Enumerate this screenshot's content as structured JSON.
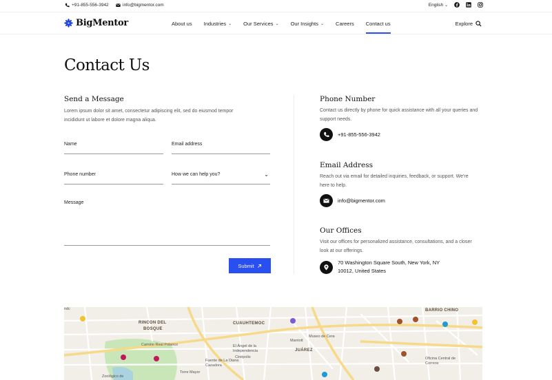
{
  "topbar": {
    "phone": "+91-855-556-3942",
    "email": "info@bigmentor.com",
    "language": "English",
    "social_icons": [
      "facebook-icon",
      "linkedin-icon",
      "instagram-icon"
    ]
  },
  "nav": {
    "brand": "BigMentor",
    "links": [
      {
        "label": "About us",
        "dropdown": false
      },
      {
        "label": "Industries",
        "dropdown": true
      },
      {
        "label": "Our Services",
        "dropdown": true
      },
      {
        "label": "Our Insights",
        "dropdown": true
      },
      {
        "label": "Careers",
        "dropdown": false
      },
      {
        "label": "Contact us",
        "dropdown": false,
        "active": true
      }
    ],
    "explore": "Explore"
  },
  "page": {
    "title": "Contact Us"
  },
  "form": {
    "title": "Send a Message",
    "description": "Lorem ipsum dolor sit amet, consectetur adipiscing elit, sed do eiusmod tempor incididunt ut labore et dolore magna aliqua.",
    "name_label": "Name",
    "email_label": "Email address",
    "phone_label": "Phone number",
    "help_label": "How we can help you?",
    "message_label": "Message",
    "submit_label": "Submit"
  },
  "contact": {
    "phone": {
      "title": "Phone Number",
      "description": "Contact us directly by phone for quick assistance with all your queries and support needs.",
      "value": "+91-855-556-3942"
    },
    "email": {
      "title": "Email Address",
      "description": "Reach out via email for detailed inquiries, feedback, or support. We're here to help.",
      "value": "info@bigmentor.com"
    },
    "offices": {
      "title": "Our Offices",
      "description": "Visit our offices for personalized assistance, consultations, and a closer look at our offerings.",
      "address_line1": "70 Washington Square South, New York, NY",
      "address_line2": "10012, United States"
    }
  },
  "map": {
    "labels": {
      "rincon": "RINCON DEL",
      "bosque": "BOSQUE",
      "cuauhtemoc": "CUAUHTEMOC",
      "barrio": "BARRIO CHINO",
      "juarez": "JUÁREZ",
      "camino": "Camino Real Polanco",
      "museo": "Museo de Cera",
      "marriott": "Marriott",
      "angel": "El Ángel de la Independencia",
      "fuente": "Fuente de La Diana Cazadora",
      "torre": "Torre Mayor",
      "cinepolis": "Cinépolis",
      "oficina": "Oficina Central de Correos",
      "zoo": "Zoológico de",
      "cdc": "ndc"
    },
    "colors": {
      "land": "#f1efe8",
      "park": "#c8e6b8",
      "road_major": "#f7d98a",
      "road": "#ffffff",
      "water": "#aad3df"
    }
  },
  "colors": {
    "accent": "#2a4ff0",
    "text": "#111111",
    "muted": "#555555"
  }
}
